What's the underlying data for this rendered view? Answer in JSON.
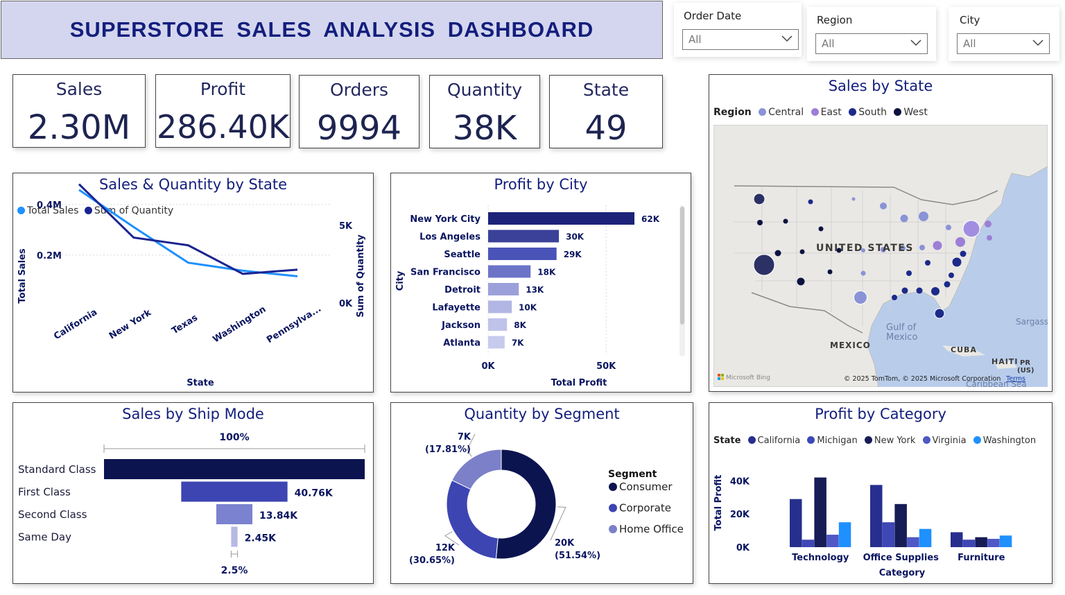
{
  "header": {
    "title": "SUPERSTORE  SALES  ANALYSIS  DASHBOARD"
  },
  "slicers": [
    {
      "label": "Order Date",
      "value": "All"
    },
    {
      "label": "Region",
      "value": "All"
    },
    {
      "label": "City",
      "value": "All"
    }
  ],
  "kpis": [
    {
      "label": "Sales",
      "value": "2.30M"
    },
    {
      "label": "Profit",
      "value": "286.40K"
    },
    {
      "label": "Orders",
      "value": "9994"
    },
    {
      "label": "Quantity",
      "value": "38K"
    },
    {
      "label": "State",
      "value": "49"
    }
  ],
  "map": {
    "title": "Sales by State",
    "legend_title": "Region",
    "legend": [
      {
        "name": "Central",
        "color": "#8a93d6"
      },
      {
        "name": "East",
        "color": "#9c7fd6"
      },
      {
        "name": "South",
        "color": "#1c2a8a"
      },
      {
        "name": "West",
        "color": "#0c1240"
      }
    ],
    "labels": {
      "country": "UNITED STATES",
      "gulf": "Gulf of\nMexico",
      "gulf1": "Gulf of",
      "gulf2": "Mexico",
      "mexico": "MEXICO",
      "cuba": "CUBA",
      "haiti": "HAITI",
      "pr1": "PR",
      "pr2": "(US)",
      "sargasso": "Sargass",
      "caribbean": "Caribbean Sea"
    },
    "attribution": "© 2025 TomTom, © 2025 Microsoft Corporation",
    "terms": "Terms",
    "bing": "Microsoft Bing"
  },
  "chart_data": [
    {
      "type": "line",
      "title": "Sales & Quantity by State",
      "xlabel": "State",
      "ylabel": "Total Sales",
      "y2label": "Sum of Quantity",
      "categories": [
        "California",
        "New York",
        "Texas",
        "Washington",
        "Pennsylva..."
      ],
      "series": [
        {
          "name": "Total Sales",
          "axis": "left",
          "color": "#1e90ff",
          "values": [
            457688,
            310876,
            170188,
            138641,
            116512
          ]
        },
        {
          "name": "Sum of Quantity",
          "axis": "right",
          "color": "#1a2490",
          "values": [
            7667,
            4224,
            3724,
            1883,
            2153
          ]
        }
      ],
      "y_ticks": [
        "0.2M",
        "0.4M"
      ],
      "y_tick_values": [
        200000,
        400000
      ],
      "ylim": [
        0,
        520000
      ],
      "y2_ticks": [
        "0K",
        "5K"
      ],
      "y2_tick_values": [
        0,
        5000
      ],
      "y2lim": [
        0,
        8500
      ]
    },
    {
      "type": "bar",
      "orientation": "horizontal",
      "title": "Profit by City",
      "xlabel": "Total Profit",
      "ylabel": "City",
      "categories": [
        "New York City",
        "Los Angeles",
        "Seattle",
        "San Francisco",
        "Detroit",
        "Lafayette",
        "Jackson",
        "Atlanta"
      ],
      "values": [
        62000,
        30000,
        29000,
        18000,
        13000,
        10000,
        8000,
        7000
      ],
      "data_labels": [
        "62K",
        "30K",
        "29K",
        "18K",
        "13K",
        "10K",
        "8K",
        "7K"
      ],
      "colors": [
        "#1c2379",
        "#3b4199",
        "#4a54b8",
        "#6c74c8",
        "#9ca0da",
        "#b2b6e4",
        "#bfc3ea",
        "#c7cbed"
      ],
      "x_ticks": [
        "0K",
        "50K"
      ],
      "x_tick_values": [
        0,
        50000
      ],
      "xlim": [
        0,
        70000
      ]
    },
    {
      "type": "bar",
      "subtype": "funnel",
      "title": "Sales by Ship Mode",
      "categories": [
        "Standard Class",
        "First Class",
        "Second Class",
        "Same Day"
      ],
      "values": [
        100,
        40.76,
        13.84,
        2.45
      ],
      "data_labels": [
        "",
        "40.76K",
        "13.84K",
        "2.45K"
      ],
      "top_label": "100%",
      "bottom_label": "2.5%",
      "colors": [
        "#0c1450",
        "#3d45b2",
        "#7b82cf",
        "#b6b9e4"
      ]
    },
    {
      "type": "pie",
      "subtype": "donut",
      "title": "Quantity by Segment",
      "legend_title": "Segment",
      "categories": [
        "Consumer",
        "Corporate",
        "Home Office"
      ],
      "values": [
        51.54,
        30.65,
        17.81
      ],
      "data_labels": [
        [
          "20K",
          "(51.54%)"
        ],
        [
          "12K",
          "(30.65%)"
        ],
        [
          "7K",
          "(17.81%)"
        ]
      ],
      "colors": [
        "#0c1450",
        "#3d45b2",
        "#7b80c9"
      ]
    },
    {
      "type": "bar",
      "subtype": "grouped",
      "title": "Profit by Category",
      "legend_title": "State",
      "xlabel": "Category",
      "ylabel": "Total Profit",
      "categories": [
        "Technology",
        "Office Supplies",
        "Furniture"
      ],
      "series": [
        {
          "name": "California",
          "color": "#262f8e",
          "values": [
            29000,
            37500,
            9000
          ]
        },
        {
          "name": "Michigan",
          "color": "#3e47b5",
          "values": [
            4500,
            15000,
            4500
          ]
        },
        {
          "name": "New York",
          "color": "#161c55",
          "values": [
            42000,
            26000,
            6000
          ]
        },
        {
          "name": "Virginia",
          "color": "#4f58c5",
          "values": [
            7500,
            6000,
            5000
          ]
        },
        {
          "name": "Washington",
          "color": "#1e90ff",
          "values": [
            15000,
            11000,
            7000
          ]
        }
      ],
      "y_ticks": [
        "0K",
        "20K",
        "40K"
      ],
      "y_tick_values": [
        0,
        20000,
        40000
      ],
      "ylim": [
        0,
        46000
      ]
    }
  ]
}
